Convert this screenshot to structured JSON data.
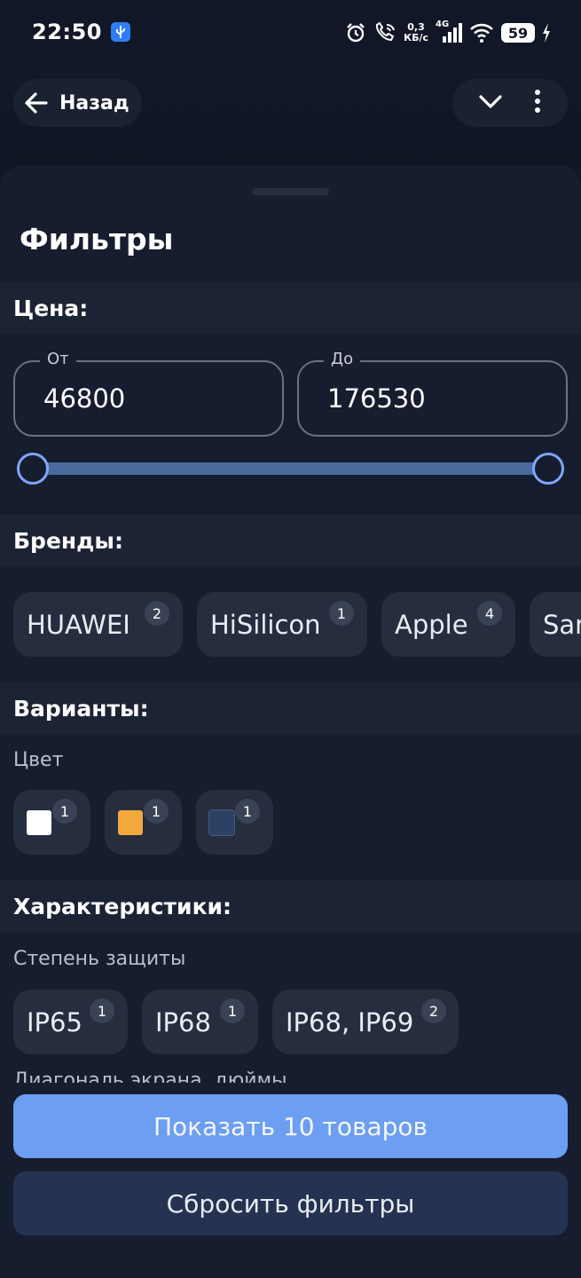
{
  "status": {
    "time": "22:50",
    "net_speed_value": "0,3",
    "net_speed_unit": "КБ/с",
    "network_type": "4G",
    "battery": "59"
  },
  "nav": {
    "back_label": "Назад"
  },
  "sheet": {
    "title": "Фильтры",
    "price": {
      "header": "Цена:",
      "from_label": "От",
      "from_value": "46800",
      "to_label": "До",
      "to_value": "176530"
    },
    "brands": {
      "header": "Бренды:",
      "items": [
        {
          "label": "HUAWEI",
          "count": "2"
        },
        {
          "label": "HiSilicon",
          "count": "1"
        },
        {
          "label": "Apple",
          "count": "4"
        },
        {
          "label": "Samsung",
          "count": ""
        }
      ]
    },
    "variants": {
      "header": "Варианты:",
      "color_label": "Цвет",
      "colors": [
        {
          "color": "#ffffff",
          "count": "1"
        },
        {
          "color": "#f2a83b",
          "count": "1"
        },
        {
          "color": "#2c4164",
          "count": "1"
        }
      ]
    },
    "characteristics": {
      "header": "Характеристики:",
      "protection_label": "Степень защиты",
      "protection_items": [
        {
          "label": "IP65",
          "count": "1"
        },
        {
          "label": "IP68",
          "count": "1"
        },
        {
          "label": "IP68, IP69",
          "count": "2"
        }
      ],
      "next_label": "Диагональ экрана, дюймы"
    }
  },
  "buttons": {
    "show_label": "Показать 10 товаров",
    "reset_label": "Сбросить фильтры"
  }
}
